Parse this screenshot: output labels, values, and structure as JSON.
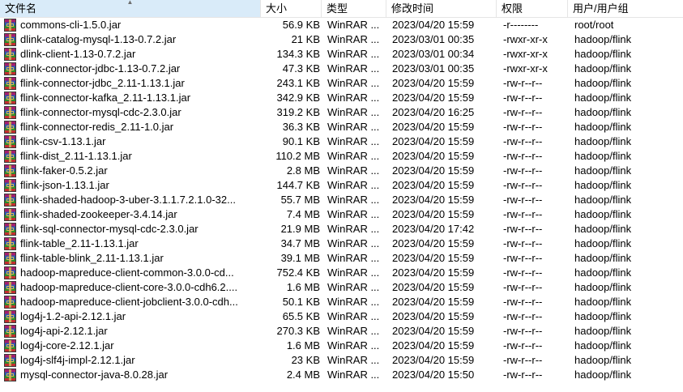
{
  "colors": {
    "header_sorted_bg": "#d9ebf9",
    "divider": "#e5e5e5"
  },
  "columns": {
    "name": "文件名",
    "size": "大小",
    "type": "类型",
    "modified": "修改时间",
    "perms": "权限",
    "owner": "用户/用户组"
  },
  "files": [
    {
      "name": "commons-cli-1.5.0.jar",
      "size": "56.9 KB",
      "type": "WinRAR ...",
      "modified": "2023/04/20 15:59",
      "perms": "-r--------",
      "owner": "root/root"
    },
    {
      "name": "dlink-catalog-mysql-1.13-0.7.2.jar",
      "size": "21 KB",
      "type": "WinRAR ...",
      "modified": "2023/03/01 00:35",
      "perms": "-rwxr-xr-x",
      "owner": "hadoop/flink"
    },
    {
      "name": "dlink-client-1.13-0.7.2.jar",
      "size": "134.3 KB",
      "type": "WinRAR ...",
      "modified": "2023/03/01 00:34",
      "perms": "-rwxr-xr-x",
      "owner": "hadoop/flink"
    },
    {
      "name": "dlink-connector-jdbc-1.13-0.7.2.jar",
      "size": "47.3 KB",
      "type": "WinRAR ...",
      "modified": "2023/03/01 00:35",
      "perms": "-rwxr-xr-x",
      "owner": "hadoop/flink"
    },
    {
      "name": "flink-connector-jdbc_2.11-1.13.1.jar",
      "size": "243.1 KB",
      "type": "WinRAR ...",
      "modified": "2023/04/20 15:59",
      "perms": "-rw-r--r--",
      "owner": "hadoop/flink"
    },
    {
      "name": "flink-connector-kafka_2.11-1.13.1.jar",
      "size": "342.9 KB",
      "type": "WinRAR ...",
      "modified": "2023/04/20 15:59",
      "perms": "-rw-r--r--",
      "owner": "hadoop/flink"
    },
    {
      "name": "flink-connector-mysql-cdc-2.3.0.jar",
      "size": "319.2 KB",
      "type": "WinRAR ...",
      "modified": "2023/04/20 16:25",
      "perms": "-rw-r--r--",
      "owner": "hadoop/flink"
    },
    {
      "name": "flink-connector-redis_2.11-1.0.jar",
      "size": "36.3 KB",
      "type": "WinRAR ...",
      "modified": "2023/04/20 15:59",
      "perms": "-rw-r--r--",
      "owner": "hadoop/flink"
    },
    {
      "name": "flink-csv-1.13.1.jar",
      "size": "90.1 KB",
      "type": "WinRAR ...",
      "modified": "2023/04/20 15:59",
      "perms": "-rw-r--r--",
      "owner": "hadoop/flink"
    },
    {
      "name": "flink-dist_2.11-1.13.1.jar",
      "size": "110.2 MB",
      "type": "WinRAR ...",
      "modified": "2023/04/20 15:59",
      "perms": "-rw-r--r--",
      "owner": "hadoop/flink"
    },
    {
      "name": "flink-faker-0.5.2.jar",
      "size": "2.8 MB",
      "type": "WinRAR ...",
      "modified": "2023/04/20 15:59",
      "perms": "-rw-r--r--",
      "owner": "hadoop/flink"
    },
    {
      "name": "flink-json-1.13.1.jar",
      "size": "144.7 KB",
      "type": "WinRAR ...",
      "modified": "2023/04/20 15:59",
      "perms": "-rw-r--r--",
      "owner": "hadoop/flink"
    },
    {
      "name": "flink-shaded-hadoop-3-uber-3.1.1.7.2.1.0-32...",
      "size": "55.7 MB",
      "type": "WinRAR ...",
      "modified": "2023/04/20 15:59",
      "perms": "-rw-r--r--",
      "owner": "hadoop/flink"
    },
    {
      "name": "flink-shaded-zookeeper-3.4.14.jar",
      "size": "7.4 MB",
      "type": "WinRAR ...",
      "modified": "2023/04/20 15:59",
      "perms": "-rw-r--r--",
      "owner": "hadoop/flink"
    },
    {
      "name": "flink-sql-connector-mysql-cdc-2.3.0.jar",
      "size": "21.9 MB",
      "type": "WinRAR ...",
      "modified": "2023/04/20 17:42",
      "perms": "-rw-r--r--",
      "owner": "hadoop/flink"
    },
    {
      "name": "flink-table_2.11-1.13.1.jar",
      "size": "34.7 MB",
      "type": "WinRAR ...",
      "modified": "2023/04/20 15:59",
      "perms": "-rw-r--r--",
      "owner": "hadoop/flink"
    },
    {
      "name": "flink-table-blink_2.11-1.13.1.jar",
      "size": "39.1 MB",
      "type": "WinRAR ...",
      "modified": "2023/04/20 15:59",
      "perms": "-rw-r--r--",
      "owner": "hadoop/flink"
    },
    {
      "name": "hadoop-mapreduce-client-common-3.0.0-cd...",
      "size": "752.4 KB",
      "type": "WinRAR ...",
      "modified": "2023/04/20 15:59",
      "perms": "-rw-r--r--",
      "owner": "hadoop/flink"
    },
    {
      "name": "hadoop-mapreduce-client-core-3.0.0-cdh6.2....",
      "size": "1.6 MB",
      "type": "WinRAR ...",
      "modified": "2023/04/20 15:59",
      "perms": "-rw-r--r--",
      "owner": "hadoop/flink"
    },
    {
      "name": "hadoop-mapreduce-client-jobclient-3.0.0-cdh...",
      "size": "50.1 KB",
      "type": "WinRAR ...",
      "modified": "2023/04/20 15:59",
      "perms": "-rw-r--r--",
      "owner": "hadoop/flink"
    },
    {
      "name": "log4j-1.2-api-2.12.1.jar",
      "size": "65.5 KB",
      "type": "WinRAR ...",
      "modified": "2023/04/20 15:59",
      "perms": "-rw-r--r--",
      "owner": "hadoop/flink"
    },
    {
      "name": "log4j-api-2.12.1.jar",
      "size": "270.3 KB",
      "type": "WinRAR ...",
      "modified": "2023/04/20 15:59",
      "perms": "-rw-r--r--",
      "owner": "hadoop/flink"
    },
    {
      "name": "log4j-core-2.12.1.jar",
      "size": "1.6 MB",
      "type": "WinRAR ...",
      "modified": "2023/04/20 15:59",
      "perms": "-rw-r--r--",
      "owner": "hadoop/flink"
    },
    {
      "name": "log4j-slf4j-impl-2.12.1.jar",
      "size": "23 KB",
      "type": "WinRAR ...",
      "modified": "2023/04/20 15:59",
      "perms": "-rw-r--r--",
      "owner": "hadoop/flink"
    },
    {
      "name": "mysql-connector-java-8.0.28.jar",
      "size": "2.4 MB",
      "type": "WinRAR ...",
      "modified": "2023/04/20 15:50",
      "perms": "-rw-r--r--",
      "owner": "hadoop/flink"
    }
  ]
}
